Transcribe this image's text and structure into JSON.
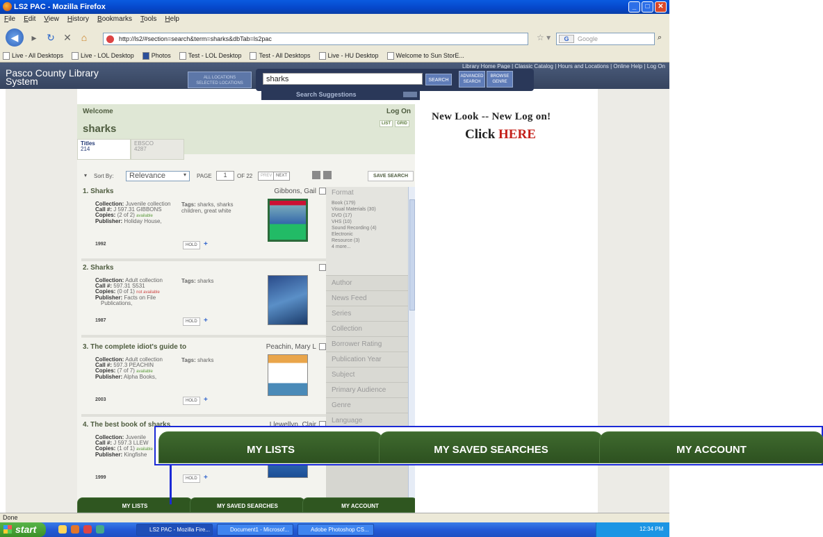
{
  "window": {
    "title": "LS2 PAC - Mozilla Firefox",
    "buttons": [
      "_",
      "□",
      "✕"
    ]
  },
  "menu": [
    "File",
    "Edit",
    "View",
    "History",
    "Bookmarks",
    "Tools",
    "Help"
  ],
  "nav": {
    "url": "http://ls2/#section=search&term=sharks&dbTab=ls2pac",
    "search_placeholder": "Google"
  },
  "bookmarks": [
    "Live - All Desktops",
    "Live - LOL Desktop",
    "Photos",
    "Test - LOL Desktop",
    "Test - All Desktops",
    "Live - HU Desktop",
    "Welcome to Sun StorE..."
  ],
  "header": {
    "library_name_line1": "Pasco County Library",
    "library_name_line2": "System",
    "top_links": "Library Home Page | Classic Catalog | Hours and Locations | Online Help | Log On",
    "locations_line1": "ALL LOCATIONS",
    "locations_line2": "SELECTED LOCATIONS",
    "search_value": "sharks",
    "search_button": "SEARCH",
    "advanced_line1": "ADVANCED",
    "advanced_line2": "SEARCH",
    "browse_line1": "BROWSE",
    "browse_line2": "GENRE",
    "suggestions": "Search Suggestions"
  },
  "results_header": {
    "welcome": "Welcome",
    "logon": "Log On",
    "query": "sharks",
    "list": "LIST",
    "grid": "GRID",
    "tabs": [
      {
        "label": "Titles",
        "count": "214"
      },
      {
        "label": "EBSCO",
        "count": "4287"
      }
    ]
  },
  "sortbar": {
    "label": "Sort By:",
    "value": "Relevance",
    "page_label": "PAGE",
    "page": "1",
    "of": "OF 22",
    "prev": "PREV",
    "next": "NEXT",
    "save": "SAVE SEARCH"
  },
  "results": [
    {
      "title": "1.  Sharks",
      "author": "Gibbons, Gail",
      "collection": "Juvenile collection",
      "call": "J 597.31 GIBBONS",
      "copies": "(2 of 2)",
      "avail": "available",
      "publisher": "Holiday House,",
      "publisher2": "",
      "tags": "sharks, sharks",
      "tags2": "children, great white",
      "year": "1992"
    },
    {
      "title": "2.  Sharks",
      "author": "",
      "collection": "Adult collection",
      "call": "597.31 S531",
      "copies": "(0 of 1)",
      "avail": "not available",
      "publisher": "Facts on File",
      "publisher2": "Publications,",
      "tags": "sharks",
      "tags2": "",
      "year": "1987"
    },
    {
      "title": "3.  The complete idiot's guide to",
      "author": "Peachin, Mary L",
      "collection": "Adult collection",
      "call": "597.3 PEACHIN",
      "copies": "(7 of 7)",
      "avail": "available",
      "publisher": "Alpha Books,",
      "publisher2": "",
      "tags": "sharks",
      "tags2": "",
      "year": "2003"
    },
    {
      "title": "4.  The best book of sharks",
      "author": "Llewellyn, Clair",
      "collection": "Juvenile",
      "call": "J 597.3 LLEW",
      "copies": "(1 of 1)",
      "avail": "available",
      "publisher": "Kingfishe",
      "publisher2": "",
      "tags": "",
      "tags2": "",
      "year": "1999"
    }
  ],
  "labels": {
    "collection": "Collection:",
    "call": "Call #:",
    "copies": "Copies:",
    "publisher": "Publisher:",
    "tags": "Tags:",
    "hold": "HOLD"
  },
  "facets": {
    "format_title": "Format",
    "format_items": [
      "Book (179)",
      "Visual Materials (30)",
      "DVD (17)",
      "VHS (10)",
      "Sound Recording (4)",
      "Electronic",
      "Resource (3)",
      "4 more..."
    ],
    "others": [
      "Author",
      "News Feed",
      "Series",
      "Collection",
      "Borrower Rating",
      "Publication Year",
      "Subject",
      "Primary Audience",
      "Genre",
      "Language"
    ]
  },
  "promo": {
    "line1": "New Look -- New Log on!",
    "line2_a": "Click ",
    "line2_b": "HERE"
  },
  "bottom_tabs": [
    "MY LISTS",
    "MY SAVED SEARCHES",
    "MY ACCOUNT"
  ],
  "status": "Done",
  "taskbar": {
    "start": "start",
    "tasks": [
      "LS2 PAC - Mozilla Fire...",
      "Document1 - Microsof...",
      "Adobe Photoshop CS..."
    ],
    "time": "12:34 PM"
  },
  "colors": {
    "header": "#3f4e6c",
    "green_tab": "#2f5620",
    "highlight": "#1a29d6"
  }
}
